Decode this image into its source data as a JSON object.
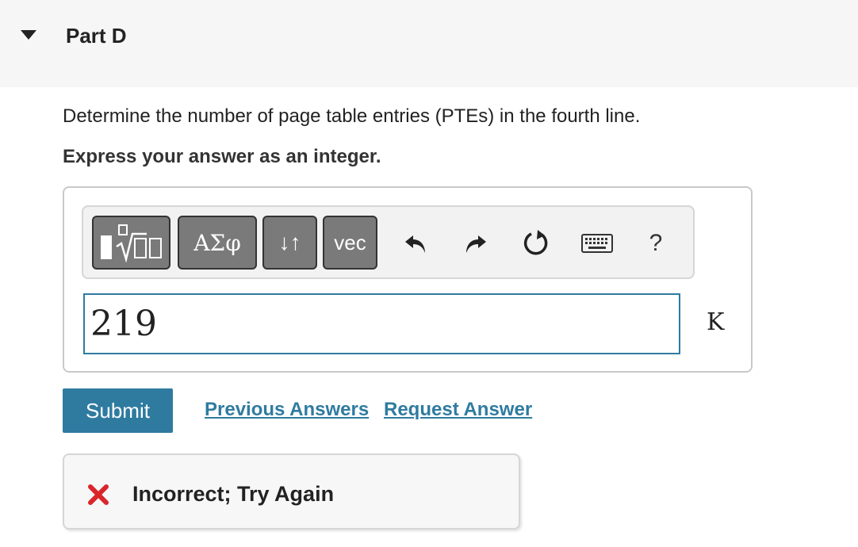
{
  "part": {
    "title": "Part D",
    "caret_icon": "caret-down-icon"
  },
  "question": {
    "prompt": "Determine the number of page table entries (PTEs) in the fourth line.",
    "instruction": "Express your answer as an integer."
  },
  "toolbar": {
    "templates_icon": "templates-sqrt-icon",
    "greek_label": "ΑΣφ",
    "arrows_label": "↓↑",
    "vec_label": "vec",
    "undo_icon": "undo-icon",
    "redo_icon": "redo-icon",
    "reset_icon": "reset-icon",
    "keyboard_icon": "keyboard-icon",
    "help_label": "?"
  },
  "answer": {
    "value": "219",
    "unit": "K"
  },
  "actions": {
    "submit_label": "Submit",
    "previous_answers_label": "Previous Answers",
    "request_answer_label": "Request Answer"
  },
  "feedback": {
    "icon": "x-icon",
    "text": "Incorrect; Try Again"
  },
  "colors": {
    "accent": "#2f7ba0",
    "error": "#d9262b",
    "button_gray": "#7a7a7a",
    "header_bg": "#f6f6f6"
  }
}
